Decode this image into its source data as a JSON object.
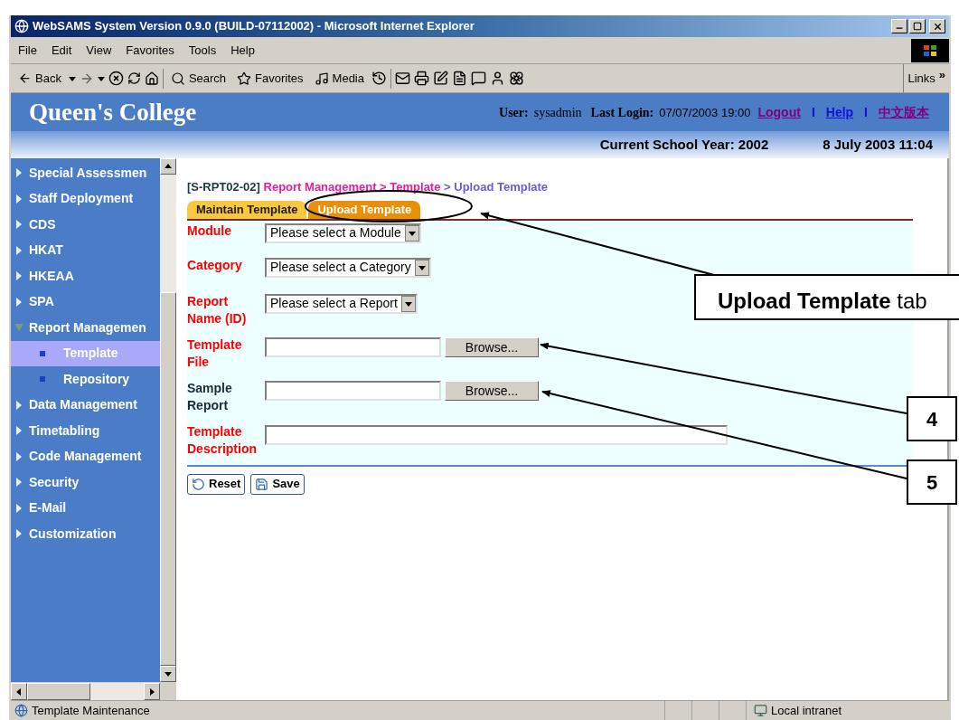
{
  "window": {
    "title": "WebSAMS System Version 0.9.0 (BUILD-07112002) - Microsoft Internet Explorer"
  },
  "menu": [
    "File",
    "Edit",
    "View",
    "Favorites",
    "Tools",
    "Help"
  ],
  "toolbar": {
    "back": "Back",
    "search": "Search",
    "favorites": "Favorites",
    "media": "Media",
    "links": "Links",
    "links_more": "»"
  },
  "header": {
    "college": "Queen's College",
    "user_label": "User:",
    "user": "sysadmin",
    "login_label": "Last Login:",
    "login": "07/07/2003 19:00",
    "links": [
      {
        "kind": "link",
        "text": "Logout",
        "visited": true
      },
      {
        "kind": "separator",
        "text": "I"
      },
      {
        "kind": "link",
        "text": "Help",
        "visited": false
      },
      {
        "kind": "separator",
        "text": "I"
      },
      {
        "kind": "link",
        "text": "中文版本",
        "visited": true
      }
    ],
    "school_year": "Current School Year: 2002",
    "datetime": "8 July 2003 11:04"
  },
  "sidebar": {
    "items": [
      {
        "label": "Special Assessmen",
        "expanded": false,
        "selected": false
      },
      {
        "label": "Staff Deployment",
        "expanded": false,
        "selected": false
      },
      {
        "label": "CDS",
        "expanded": false,
        "selected": false
      },
      {
        "label": "HKAT",
        "expanded": false,
        "selected": false
      },
      {
        "label": "HKEAA",
        "expanded": false,
        "selected": false
      },
      {
        "label": "SPA",
        "expanded": false,
        "selected": false
      },
      {
        "label": "Report Managemen",
        "expanded": true,
        "selected": false,
        "children": [
          {
            "label": "Template",
            "selected": true
          },
          {
            "label": "Repository",
            "selected": false
          }
        ]
      },
      {
        "label": "Data Management",
        "expanded": false,
        "selected": false
      },
      {
        "label": "Timetabling",
        "expanded": false,
        "selected": false
      },
      {
        "label": "Code Management",
        "expanded": false,
        "selected": false
      },
      {
        "label": "Security",
        "expanded": false,
        "selected": false
      },
      {
        "label": "E-Mail",
        "expanded": false,
        "selected": false
      },
      {
        "label": "Customization",
        "expanded": false,
        "selected": false
      }
    ]
  },
  "breadcrumb": {
    "code": "[S-RPT02-02]",
    "path": "Report Management > Template",
    "current": "> Upload Template"
  },
  "tabs": [
    {
      "label": "Maintain Template",
      "selected": false
    },
    {
      "label": "Upload Template",
      "selected": true
    }
  ],
  "form": {
    "fields": [
      {
        "kind": "select",
        "label": "Module",
        "required": true,
        "value": "Please select a Module"
      },
      {
        "kind": "select",
        "label": "Category",
        "required": true,
        "value": "Please select a Category"
      },
      {
        "kind": "select",
        "label": "Report Name (ID)",
        "required": true,
        "value": "Please select a Report"
      },
      {
        "kind": "file",
        "label": "Template File",
        "required": true,
        "button": "Browse..."
      },
      {
        "kind": "file",
        "label": "Sample Report",
        "required": false,
        "button": "Browse..."
      },
      {
        "kind": "text",
        "label": "Template Description",
        "required": true
      }
    ],
    "buttons": [
      {
        "kind": "reset",
        "label": "Reset"
      },
      {
        "kind": "save",
        "label": "Save"
      }
    ]
  },
  "status_bar": {
    "text": "Template Maintenance",
    "zone": "Local intranet"
  },
  "callouts": [
    {
      "kind": "label",
      "text": "**Upload Template** tab"
    },
    {
      "kind": "number",
      "text": "4"
    },
    {
      "kind": "number",
      "text": "5"
    }
  ]
}
